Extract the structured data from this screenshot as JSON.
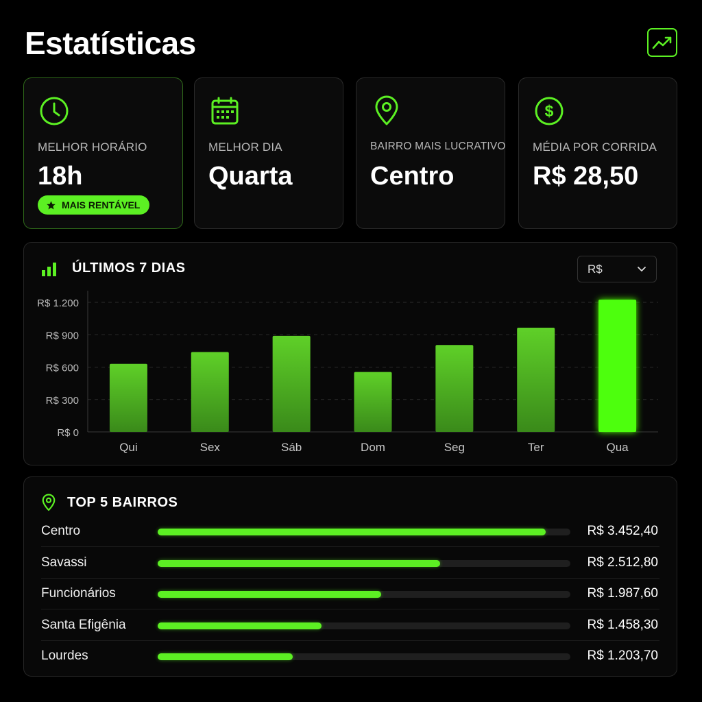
{
  "header": {
    "title": "Estatísticas",
    "trend_icon": "trending-up-icon"
  },
  "accent": "#5cf023",
  "cards": [
    {
      "icon": "clock-icon",
      "label": "MELHOR HORÁRIO",
      "value": "18h",
      "badge": "MAIS RENTÁVEL"
    },
    {
      "icon": "calendar-icon",
      "label": "MELHOR DIA",
      "value": "Quarta"
    },
    {
      "icon": "map-pin-icon",
      "label": "BAIRRO MAIS LUCRATIVO",
      "value": "Centro"
    },
    {
      "icon": "dollar-icon",
      "label": "MÉDIA POR CORRIDA",
      "value": "R$ 28,50"
    }
  ],
  "chart_panel": {
    "title": "ÚLTIMOS 7 DIAS",
    "currency_select": "R$"
  },
  "chart_data": {
    "type": "bar",
    "categories": [
      "Qui",
      "Sex",
      "Sáb",
      "Dom",
      "Seg",
      "Ter",
      "Qua"
    ],
    "values": [
      630,
      740,
      890,
      555,
      805,
      965,
      1225
    ],
    "ylim": [
      0,
      1200
    ],
    "yticks": [
      0,
      300,
      600,
      900,
      1200
    ],
    "ytick_labels": [
      "R$ 0",
      "R$ 300",
      "R$ 600",
      "R$ 900",
      "R$ 1.200"
    ],
    "highlight_category": "Qua",
    "grid": true
  },
  "top_bairros": {
    "title": "TOP 5 BAIRROS",
    "rows": [
      {
        "name": "Centro",
        "amount": "R$ 3.452,40",
        "value": 3452.4
      },
      {
        "name": "Savassi",
        "amount": "R$ 2.512,80",
        "value": 2512.8
      },
      {
        "name": "Funcionários",
        "amount": "R$ 1.987,60",
        "value": 1987.6
      },
      {
        "name": "Santa Efigênia",
        "amount": "R$ 1.458,30",
        "value": 1458.3
      },
      {
        "name": "Lourdes",
        "amount": "R$ 1.203,70",
        "value": 1203.7
      }
    ]
  }
}
